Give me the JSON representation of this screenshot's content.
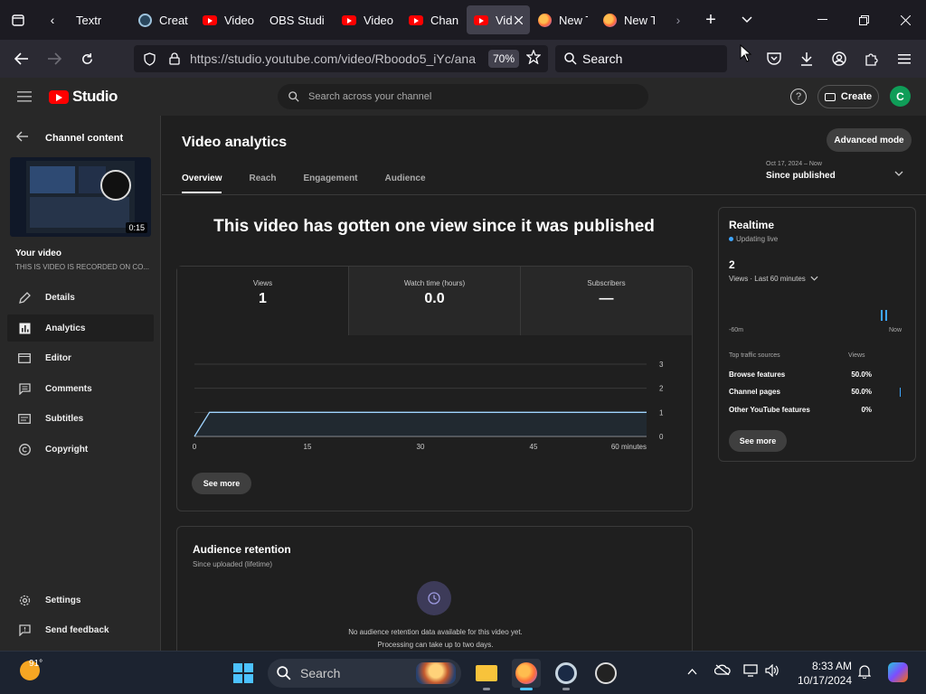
{
  "browser": {
    "tabs": [
      {
        "label": "Textr",
        "icon": "document-icon",
        "active": false
      },
      {
        "label": "Creat",
        "icon": "steam-icon",
        "active": false
      },
      {
        "label": "Video",
        "icon": "youtube-icon",
        "active": false
      },
      {
        "label": "OBS Studi",
        "icon": "",
        "active": false
      },
      {
        "label": "Video",
        "icon": "youtube-icon",
        "active": false
      },
      {
        "label": "Chan",
        "icon": "youtube-icon",
        "active": false
      },
      {
        "label": "Vid",
        "icon": "youtube-icon",
        "active": true
      },
      {
        "label": "New T",
        "icon": "firefox-icon",
        "active": false
      },
      {
        "label": "New T",
        "icon": "firefox-icon",
        "active": false
      }
    ],
    "url": "https://studio.youtube.com/video/Rboodo5_iYc/ana",
    "zoom": "70%",
    "search_placeholder": "Search"
  },
  "studio": {
    "logo_text": "Studio",
    "search_placeholder": "Search across your channel",
    "help_glyph": "?",
    "create_label": "Create",
    "avatar_initial": "C"
  },
  "sidebar": {
    "back_label": "Channel content",
    "video_duration": "0:15",
    "your_video_label": "Your video",
    "video_description": "THIS IS VIDEO IS RECORDED ON CO...",
    "items": [
      {
        "label": "Details",
        "icon": "pencil-icon",
        "active": false
      },
      {
        "label": "Analytics",
        "icon": "analytics-icon",
        "active": true
      },
      {
        "label": "Editor",
        "icon": "film-icon",
        "active": false
      },
      {
        "label": "Comments",
        "icon": "comment-icon",
        "active": false
      },
      {
        "label": "Subtitles",
        "icon": "subtitles-icon",
        "active": false
      },
      {
        "label": "Copyright",
        "icon": "copyright-icon",
        "active": false
      }
    ],
    "footer": [
      {
        "label": "Settings",
        "icon": "gear-icon"
      },
      {
        "label": "Send feedback",
        "icon": "feedback-icon"
      }
    ]
  },
  "analytics": {
    "title": "Video analytics",
    "advanced_mode": "Advanced mode",
    "tabs": [
      "Overview",
      "Reach",
      "Engagement",
      "Audience"
    ],
    "date_range": {
      "range": "Oct 17, 2024 – Now",
      "label": "Since published"
    },
    "headline": "This video has gotten one view since it was published",
    "metrics": [
      {
        "label": "Views",
        "value": "1"
      },
      {
        "label": "Watch time (hours)",
        "value": "0.0"
      },
      {
        "label": "Subscribers",
        "value": "—"
      }
    ],
    "see_more": "See more",
    "retention": {
      "title": "Audience retention",
      "subtitle": "Since uploaded (lifetime)",
      "message_1": "No audience retention data available for this video yet.",
      "message_2": "Processing can take up to two days."
    }
  },
  "realtime": {
    "title": "Realtime",
    "status": "Updating live",
    "count": "2",
    "views_selector": "Views · Last 60 minutes",
    "axis_start": "-60m",
    "axis_end": "Now",
    "bars": [
      {
        "minute": -2,
        "views": 1
      },
      {
        "minute": -1,
        "views": 1
      }
    ],
    "sources_header": "Top traffic sources",
    "views_header": "Views",
    "sources": [
      {
        "name": "Browse features",
        "pct": "50.0%"
      },
      {
        "name": "Channel pages",
        "pct": "50.0%"
      },
      {
        "name": "Other YouTube features",
        "pct": "0%"
      }
    ],
    "see_more": "See more"
  },
  "chart_data": {
    "type": "line",
    "title": "",
    "xlabel": "",
    "ylabel": "",
    "x_ticks": [
      "0",
      "15",
      "30",
      "45",
      "60 minutes"
    ],
    "y_ticks": [
      "0",
      "1",
      "2",
      "3"
    ],
    "xlim": [
      0,
      60
    ],
    "ylim": [
      0,
      3
    ],
    "series": [
      {
        "x": [
          0,
          2,
          3,
          60
        ],
        "y": [
          0,
          1,
          1,
          1
        ]
      }
    ],
    "grid": true
  },
  "taskbar": {
    "temperature": "91°",
    "search_placeholder": "Search",
    "time": "8:33 AM",
    "date": "10/17/2024",
    "apps": [
      "file-explorer-icon",
      "firefox-icon",
      "steam-icon",
      "obs-icon"
    ]
  },
  "colors": {
    "accent": "#3ea6ff",
    "brand": "#ff0000",
    "avatar": "#0f9d58"
  }
}
